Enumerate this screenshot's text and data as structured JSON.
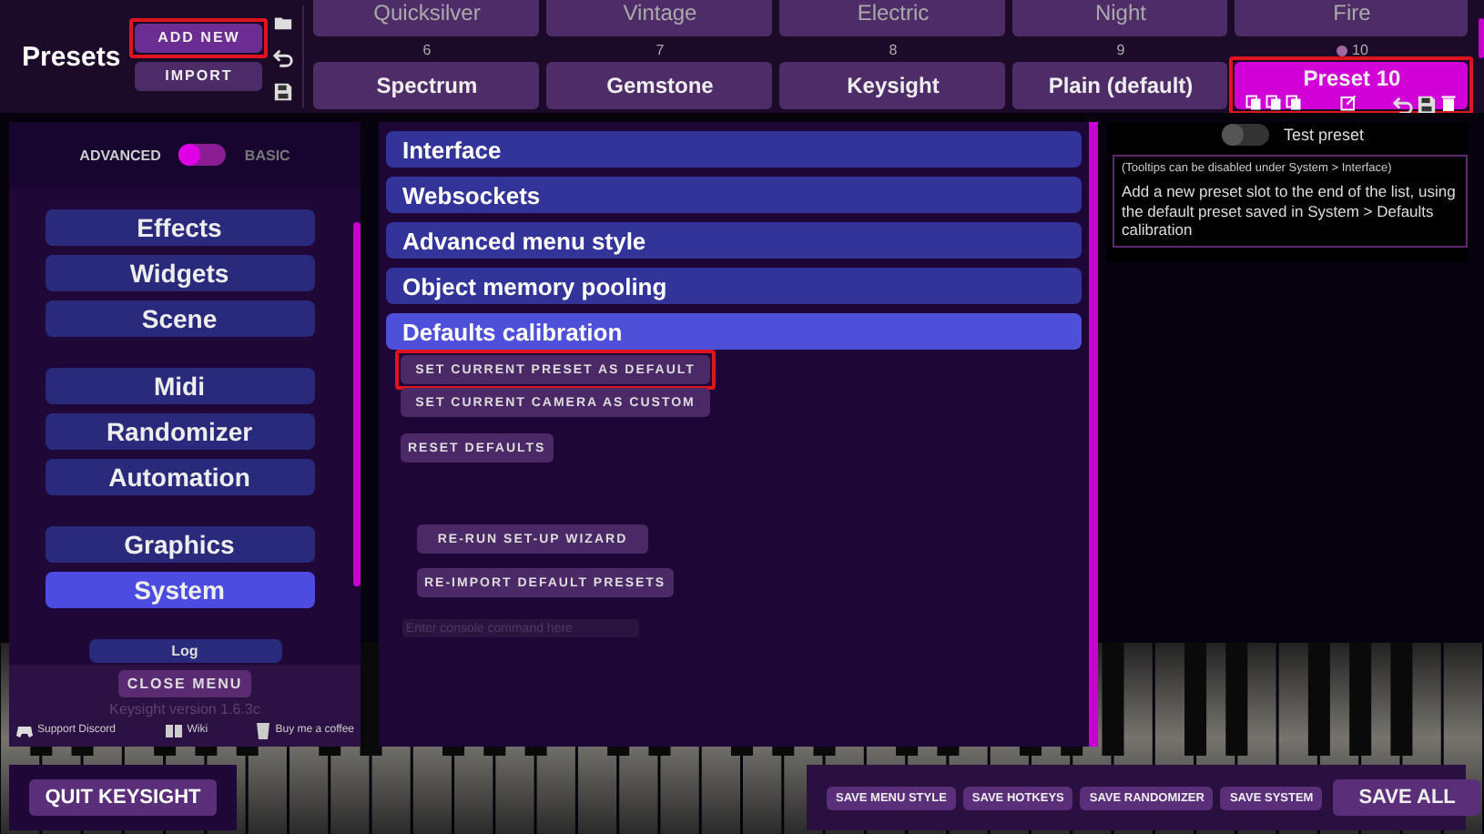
{
  "top_bar": {
    "title": "Presets",
    "buttons": [
      {
        "label": "ADD NEW",
        "highlighted": true
      },
      {
        "label": "IMPORT",
        "highlighted": false
      }
    ],
    "preset_rows": [
      [
        {
          "name": "Quicksilver",
          "selected": false,
          "highlighted": false
        },
        {
          "name": "Vintage",
          "selected": false,
          "highlighted": false
        },
        {
          "name": "Electric",
          "selected": false,
          "highlighted": false
        },
        {
          "name": "Night",
          "selected": false,
          "highlighted": false
        },
        {
          "name": "Fire",
          "selected": false,
          "highlighted": false
        }
      ],
      [
        {
          "number": "6",
          "name": "Spectrum",
          "selected": false,
          "highlighted": false
        },
        {
          "number": "7",
          "name": "Gemstone",
          "selected": false,
          "highlighted": false
        },
        {
          "number": "8",
          "name": "Keysight",
          "selected": false,
          "highlighted": false
        },
        {
          "number": "9",
          "name": "Plain (default)",
          "selected": false,
          "highlighted": false
        },
        {
          "number": "10",
          "name": "Preset 10",
          "selected": true,
          "highlighted": true
        }
      ]
    ]
  },
  "sidebar": {
    "mode": [
      {
        "label": "ADVANCED",
        "selected": true
      },
      {
        "label": "BASIC",
        "selected": false
      }
    ],
    "groups": [
      [
        {
          "label": "Effects",
          "selected": false
        },
        {
          "label": "Widgets",
          "selected": false
        },
        {
          "label": "Scene",
          "selected": false
        }
      ],
      [
        {
          "label": "Midi",
          "selected": false
        },
        {
          "label": "Randomizer",
          "selected": false
        },
        {
          "label": "Automation",
          "selected": false
        }
      ],
      [
        {
          "label": "Graphics",
          "selected": false
        },
        {
          "label": "System",
          "selected": true
        }
      ]
    ],
    "log_button": "Log",
    "close_button": "CLOSE MENU",
    "version": "Keysight version 1.6.3c",
    "links": [
      {
        "kind": "chat",
        "label": "Support Discord"
      },
      {
        "kind": "book",
        "label": "Wiki"
      },
      {
        "kind": "cup",
        "label": "Buy me a coffee"
      }
    ]
  },
  "settings": {
    "sections": [
      {
        "title": "Interface",
        "expanded": false
      },
      {
        "title": "Websockets",
        "expanded": false
      },
      {
        "title": "Advanced menu style",
        "expanded": false
      },
      {
        "title": "Object memory pooling",
        "expanded": false
      },
      {
        "title": "Defaults calibration",
        "expanded": true
      }
    ],
    "calibration_actions": [
      {
        "label": "SET CURRENT PRESET AS DEFAULT",
        "highlighted": true
      },
      {
        "label": "SET CURRENT CAMERA AS CUSTOM",
        "highlighted": false
      },
      {
        "label": "RESET DEFAULTS",
        "highlighted": false
      }
    ],
    "maintenance_actions": [
      {
        "label": "RE-RUN SET-UP WIZARD",
        "highlighted": false
      },
      {
        "label": "RE-IMPORT DEFAULT PRESETS",
        "highlighted": false
      }
    ],
    "console": {
      "placeholder": "Enter console command here"
    }
  },
  "preview": {
    "test_toggle": {
      "label": "Test preset",
      "on": false
    },
    "tooltip": {
      "hint": "(Tooltips can be disabled under System > Interface)",
      "text": "Add a new preset slot to the end of the list, using the default preset saved in System > Defaults calibration"
    }
  },
  "bottom_bar": {
    "quit_button": "QUIT KEYSIGHT",
    "save_buttons": [
      {
        "label": "SAVE MENU STYLE",
        "kind": "small"
      },
      {
        "label": "SAVE HOTKEYS",
        "kind": "small"
      },
      {
        "label": "SAVE RANDOMIZER",
        "kind": "small"
      },
      {
        "label": "SAVE SYSTEM",
        "kind": "small"
      },
      {
        "label": "SAVE ALL",
        "kind": "large"
      }
    ]
  }
}
